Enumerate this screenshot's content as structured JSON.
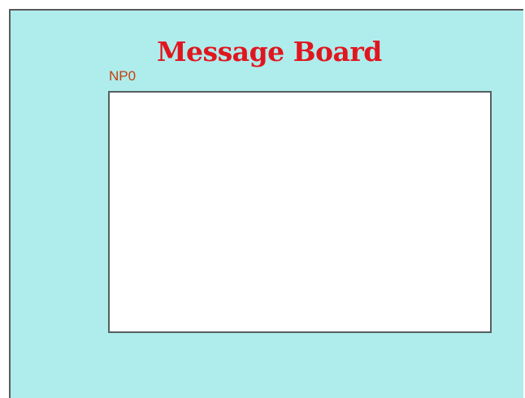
{
  "board": {
    "title": "Message Board",
    "field_label": "NP0",
    "message_text": ""
  },
  "colors": {
    "background": "#afecec",
    "title": "#e0161f",
    "label": "#c2410c",
    "panel": "#ffffff",
    "border": "#555f5f"
  }
}
